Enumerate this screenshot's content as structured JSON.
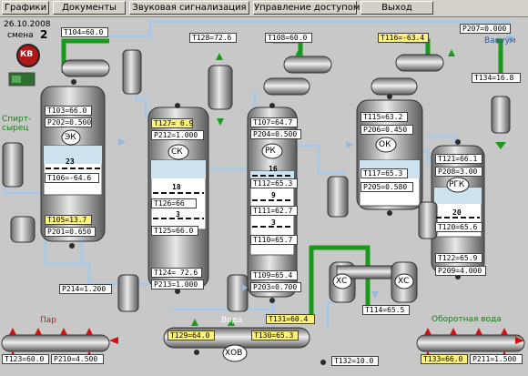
{
  "menu": {
    "charts": "Графики",
    "documents": "Документы",
    "alarm": "Звуковая сигнализация",
    "access": "Управление доступом",
    "exit": "Выход"
  },
  "header": {
    "date": "26.10.2008",
    "shift_label": "смена",
    "shift_number": "2",
    "logo": "КВ"
  },
  "labels": {
    "vacuum": "Вакуум",
    "spirit_raw": "Спирт-\nсырец",
    "steam": "Пар",
    "water": "Вода",
    "recycle_water": "Оборотная вода"
  },
  "columns": {
    "ek": "ЭК",
    "sk": "СК",
    "rk": "РК",
    "ok": "ОК",
    "rgk": "РГК",
    "xs1": "ХС",
    "xs2": "ХС",
    "xov": "ХОВ"
  },
  "trays": {
    "ek_23": "23",
    "sk_18": "18",
    "sk_3": "3",
    "rk_16": "16",
    "rk_9": "9",
    "rk_3": "3",
    "rgk_20": "20"
  },
  "tags": {
    "t104": "T104=60.0",
    "t103": "T103=66.0",
    "p202": "P202=0.500",
    "t106": "T106=-64.6",
    "t105": "T105=13.7",
    "p201": "P201=0.650",
    "t128": "T128=72.6",
    "t127": "T127= 6.9",
    "p212": "P212=1.000",
    "t126": "T126=66",
    "t125": "T125=66.0",
    "t124": "T124= 72.6",
    "p213": "P213=1.000",
    "p214": "P214=1.200",
    "t108": "T108=60.0",
    "t107": "T107=64.7",
    "p204": "P204=0.500",
    "t112": "T112=65.3",
    "t111": "T111=62.7",
    "t110": "T110=65.7",
    "t109": "T109=65.4",
    "p203": "P203=0.700",
    "t116": "T116=-63.4",
    "p207": "P207=0.000",
    "t115": "T115=63.2",
    "p206": "P206=0.450",
    "t117": "T117=65.3",
    "p205": "P205=0.580",
    "t134": "T134=16.8",
    "t121": "T121=66.1",
    "p208": "P208=3.00",
    "t120": "T120=65.6",
    "t122": "T122=65.9",
    "p209": "P209=4.000",
    "t114": "T114=65.5",
    "t131": "T131=60.4",
    "t129": "T129=64.0",
    "t130": "T130=65.3",
    "t132": "T132=10.0",
    "t123": "T123=60.0",
    "p210": "P210=4.500",
    "t133": "T133=66.0",
    "p211": "P211=1.500"
  },
  "colors": {
    "background": "#c8c8c8",
    "pipe_green": "#1a9a1a",
    "pipe_blue": "#a8c8e8",
    "tag_yellow": "#fff27a",
    "alarm_red": "#d01010"
  }
}
